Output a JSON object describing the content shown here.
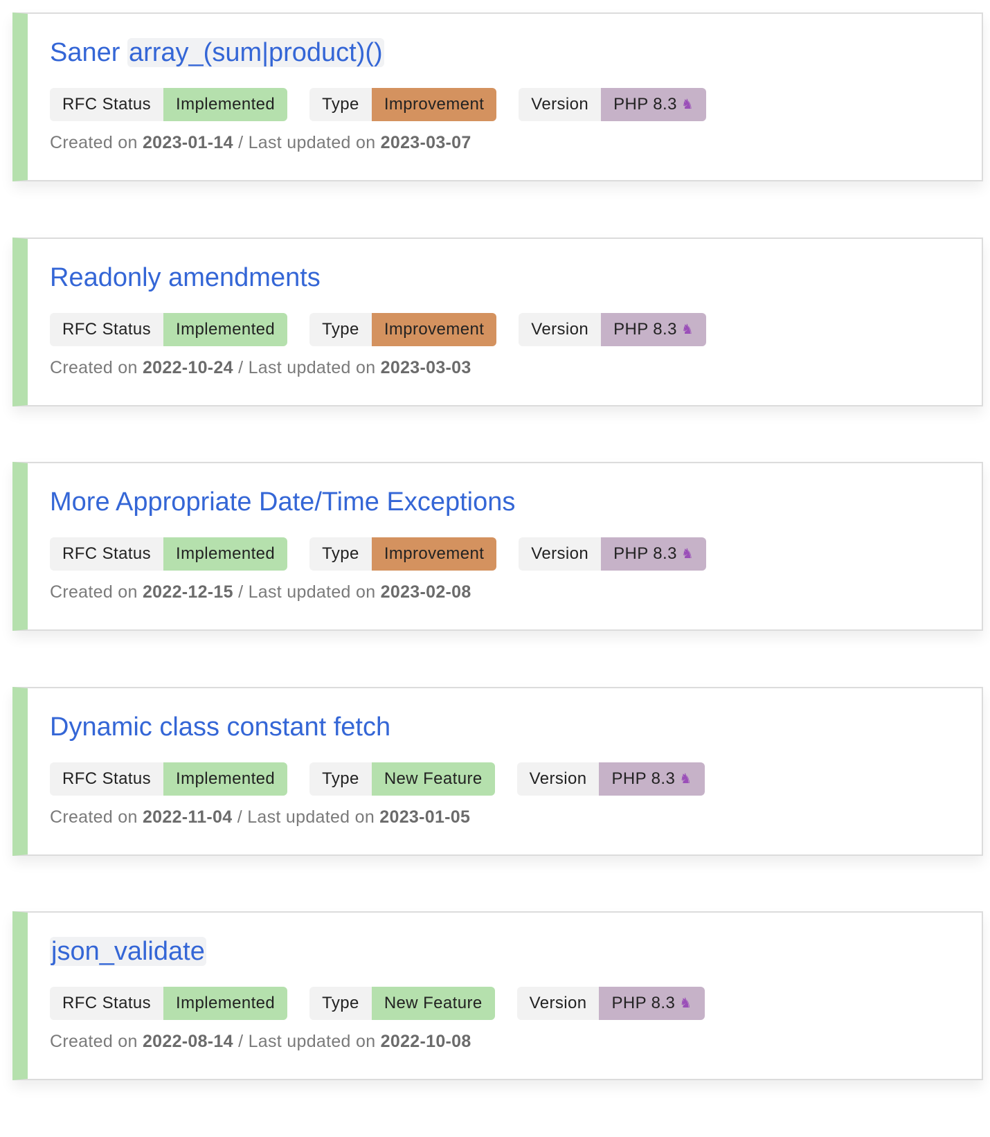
{
  "labels": {
    "status_key": "RFC Status",
    "type_key": "Type",
    "version_key": "Version",
    "created_prefix": "Created on",
    "updated_prefix": "/ Last updated on",
    "unicorn_icon": "unicorn-icon"
  },
  "colors": {
    "card_accent": "#b5e0ad",
    "title_link": "#3466d6",
    "implemented": "#b5e0ad",
    "improvement": "#d4925f",
    "new_feature": "#b5e0ad",
    "version": "#c6b2c8"
  },
  "rfcs": [
    {
      "title_prefix": "Saner ",
      "title_code": "array_(sum|product)()",
      "status": "Implemented",
      "type": "Improvement",
      "version": "PHP 8.3",
      "created": "2023-01-14",
      "updated": "2023-03-07"
    },
    {
      "title_prefix": "Readonly amendments",
      "title_code": "",
      "status": "Implemented",
      "type": "Improvement",
      "version": "PHP 8.3",
      "created": "2022-10-24",
      "updated": "2023-03-03"
    },
    {
      "title_prefix": "More Appropriate Date/Time Exceptions",
      "title_code": "",
      "status": "Implemented",
      "type": "Improvement",
      "version": "PHP 8.3",
      "created": "2022-12-15",
      "updated": "2023-02-08"
    },
    {
      "title_prefix": "Dynamic class constant fetch",
      "title_code": "",
      "status": "Implemented",
      "type": "New Feature",
      "version": "PHP 8.3",
      "created": "2022-11-04",
      "updated": "2023-01-05"
    },
    {
      "title_prefix": "",
      "title_code": "json_validate",
      "status": "Implemented",
      "type": "New Feature",
      "version": "PHP 8.3",
      "created": "2022-08-14",
      "updated": "2022-10-08"
    }
  ]
}
